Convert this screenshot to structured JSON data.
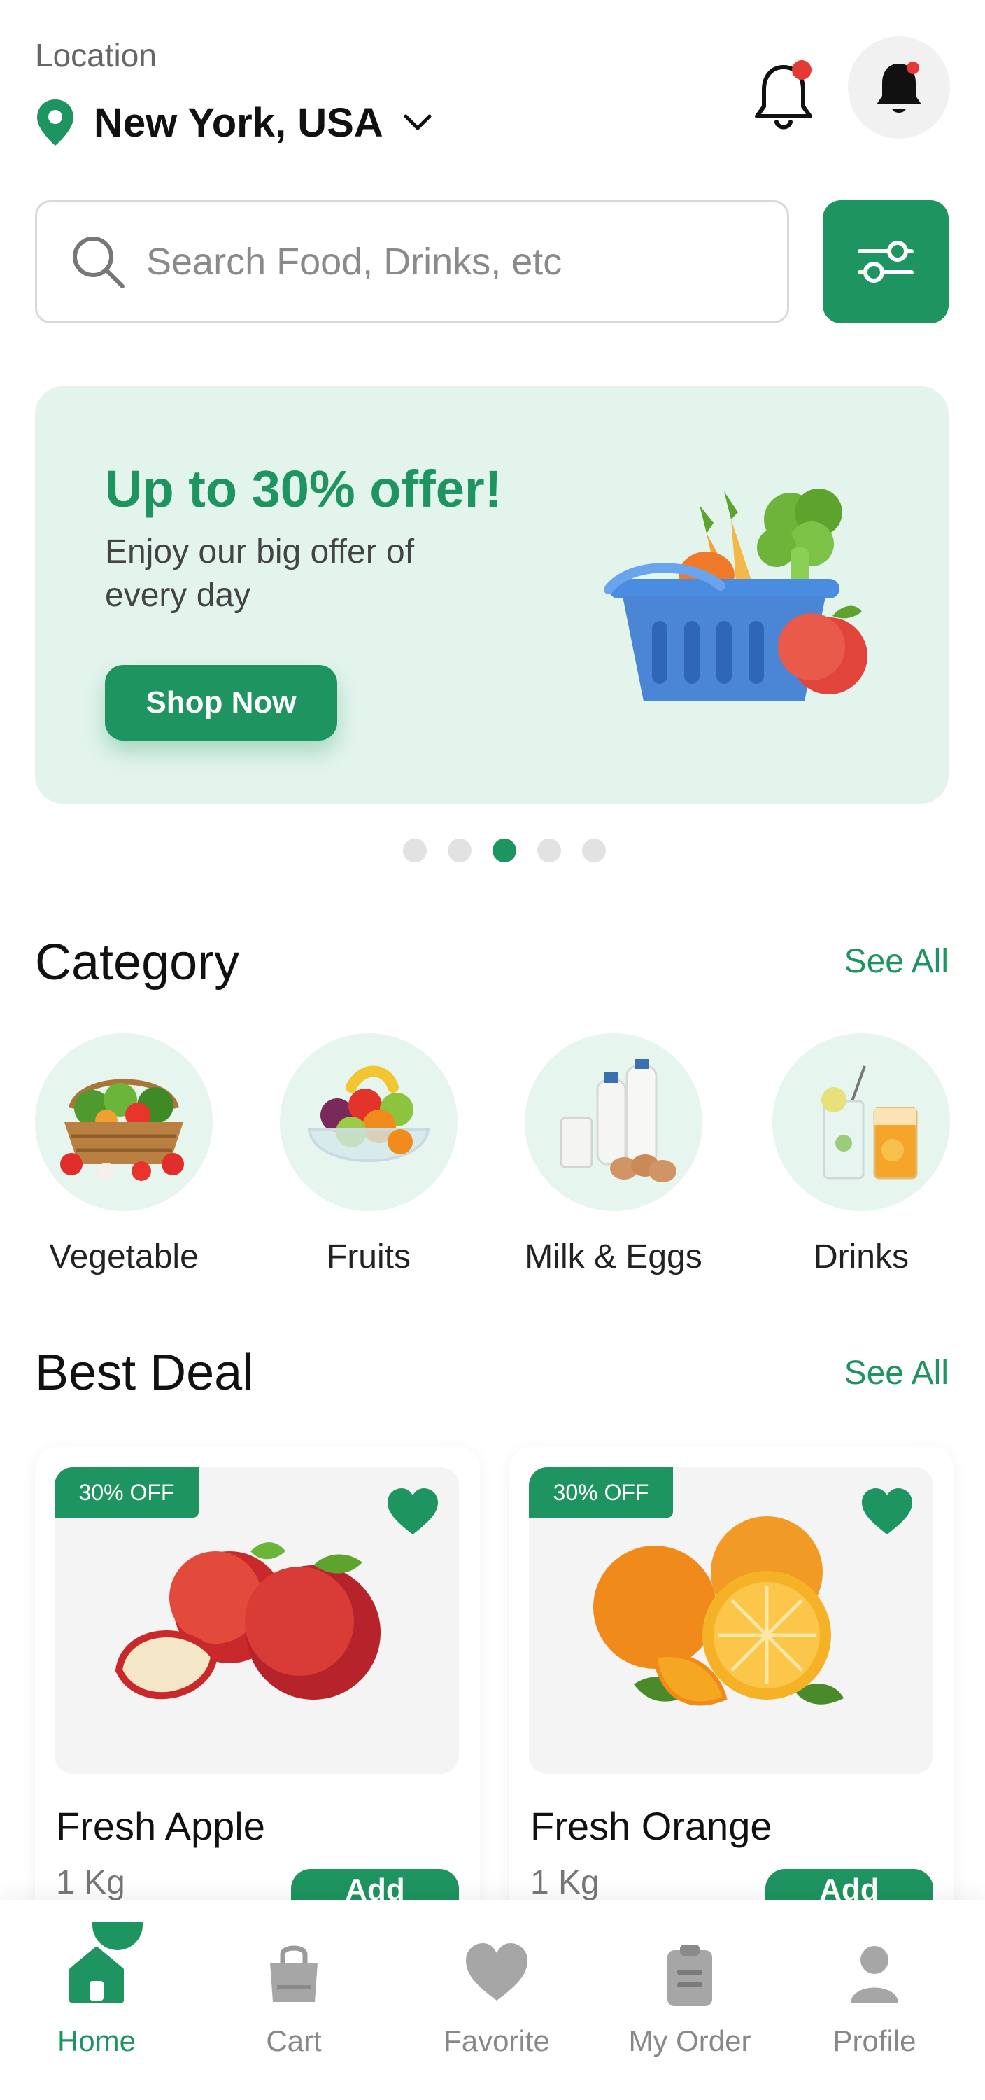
{
  "header": {
    "location_label": "Location",
    "location_value": "New York, USA",
    "icons": [
      "location-pin-icon",
      "chevron-down-icon",
      "bell-icon",
      "bell-icon"
    ]
  },
  "search": {
    "placeholder": "Search Food, Drinks, etc",
    "value": ""
  },
  "banner": {
    "title": "Up to 30% offer!",
    "subtitle": "Enjoy our big offer of every day",
    "cta": "Shop Now",
    "active_slide": 3,
    "slide_count": 5
  },
  "category_section": {
    "title": "Category",
    "see_all": "See All",
    "items": [
      {
        "label": "Vegetable"
      },
      {
        "label": "Fruits"
      },
      {
        "label": "Milk & Eggs"
      },
      {
        "label": "Drinks"
      }
    ]
  },
  "best_deal_section": {
    "title": "Best Deal",
    "see_all": "See All",
    "products": [
      {
        "badge": "30% OFF",
        "name": "Fresh Apple",
        "weight": "1 Kg",
        "add_label": "Add",
        "favorited": true
      },
      {
        "badge": "30% OFF",
        "name": "Fresh Orange",
        "weight": "1 Kg",
        "add_label": "Add",
        "favorited": true
      }
    ]
  },
  "bottom_nav": {
    "active": "Home",
    "items": [
      {
        "label": "Home",
        "icon": "home-icon"
      },
      {
        "label": "Cart",
        "icon": "shopping-bag-icon"
      },
      {
        "label": "Favorite",
        "icon": "heart-icon"
      },
      {
        "label": "My Order",
        "icon": "clipboard-icon"
      },
      {
        "label": "Profile",
        "icon": "user-icon"
      }
    ]
  },
  "colors": {
    "primary": "#1e9460",
    "banner_bg": "#e3f4ec",
    "notification_dot": "#e53935"
  }
}
